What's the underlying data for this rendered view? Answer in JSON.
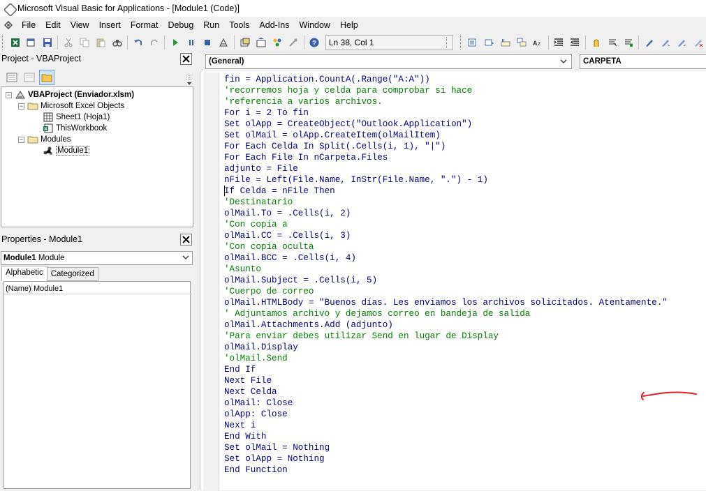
{
  "window": {
    "title": "Microsoft Visual Basic for Applications - [Module1 (Code)]"
  },
  "menu": {
    "items": [
      {
        "label": "File"
      },
      {
        "label": "Edit"
      },
      {
        "label": "View"
      },
      {
        "label": "Insert"
      },
      {
        "label": "Format"
      },
      {
        "label": "Debug"
      },
      {
        "label": "Run"
      },
      {
        "label": "Tools"
      },
      {
        "label": "Add-Ins"
      },
      {
        "label": "Window"
      },
      {
        "label": "Help"
      }
    ]
  },
  "toolbar": {
    "status": "Ln 38, Col 1",
    "icons_left": [
      "excel-icon",
      "insert-userform-icon",
      "save-icon",
      "cut-icon",
      "copy-icon",
      "paste-icon",
      "find-icon",
      "undo-icon",
      "redo-icon"
    ],
    "icons_run": [
      "run-icon",
      "pause-icon",
      "stop-icon",
      "design-mode-icon",
      "project-explorer-icon",
      "properties-icon",
      "object-browser-icon",
      "toolbox-icon",
      "help-icon"
    ],
    "icons_right": [
      "list-properties-icon",
      "list-constants-icon",
      "quick-info-icon",
      "parameter-info-icon",
      "complete-word-icon",
      "indent-icon",
      "outdent-icon",
      "toggle-breakpoint-icon",
      "comment-block-icon",
      "uncomment-block-icon",
      "toggle-bookmark-icon",
      "next-bookmark-icon",
      "previous-bookmark-icon",
      "clear-bookmarks-icon"
    ]
  },
  "project": {
    "title": "Project - VBAProject",
    "tree": [
      {
        "label": "VBAProject (Enviador.xlsm)",
        "bold": true
      },
      {
        "label": "Microsoft Excel Objects"
      },
      {
        "label": "Sheet1 (Hoja1)"
      },
      {
        "label": "ThisWorkbook"
      },
      {
        "label": "Modules"
      },
      {
        "label": "Module1"
      }
    ]
  },
  "properties": {
    "title": "Properties - Module1",
    "object_name": "Module1",
    "object_type": "Module",
    "tabs": [
      {
        "label": "Alphabetic"
      },
      {
        "label": "Categorized"
      }
    ],
    "rows": [
      {
        "name": "(Name)",
        "value": "Module1"
      }
    ]
  },
  "code": {
    "object_combo": "(General)",
    "proc_combo": "CARPETA",
    "lines": [
      {
        "text": "fin = Application.CountA(.Range(\"A:A\"))",
        "comment": false
      },
      {
        "text": "'recorremos hoja y celda para comprobar si hace",
        "comment": true
      },
      {
        "text": "'referencia a varios archivos.",
        "comment": true
      },
      {
        "text": "For i = 2 To fin",
        "comment": false
      },
      {
        "text": "Set olApp = CreateObject(\"Outlook.Application\")",
        "comment": false
      },
      {
        "text": "Set olMail = olApp.CreateItem(olMailItem)",
        "comment": false
      },
      {
        "text": "For Each Celda In Split(.Cells(i, 1), \"|\")",
        "comment": false
      },
      {
        "text": "For Each File In nCarpeta.Files",
        "comment": false
      },
      {
        "text": "adjunto = File",
        "comment": false
      },
      {
        "text": "nFile = Left(File.Name, InStr(File.Name, \".\") - 1)",
        "comment": false
      },
      {
        "text": "If Celda = nFile Then",
        "comment": false
      },
      {
        "text": "'Destinatario",
        "comment": true
      },
      {
        "text": "olMail.To = .Cells(i, 2)",
        "comment": false
      },
      {
        "text": "'Con copia a",
        "comment": true
      },
      {
        "text": "olMail.CC = .Cells(i, 3)",
        "comment": false
      },
      {
        "text": "'Con copia oculta",
        "comment": true
      },
      {
        "text": "olMail.BCC = .Cells(i, 4)",
        "comment": false
      },
      {
        "text": "'Asunto",
        "comment": true
      },
      {
        "text": "olMail.Subject = .Cells(i, 5)",
        "comment": false
      },
      {
        "text": "'Cuerpo de correo",
        "comment": true
      },
      {
        "text": "olMail.HTMLBody = \"Buenos días. Les enviamos los archivos solicitados. Atentamente.\"",
        "comment": false
      },
      {
        "text": "' Adjuntamos archivo y dejamos correo en bandeja de salida",
        "comment": true
      },
      {
        "text": "olMail.Attachments.Add (adjunto)",
        "comment": false
      },
      {
        "text": "'Para enviar debes utilizar Send en lugar de Display",
        "comment": true
      },
      {
        "text": "olMail.Display",
        "comment": false
      },
      {
        "text": "'olMail.Send",
        "comment": true
      },
      {
        "text": "End If",
        "comment": false
      },
      {
        "text": "Next File",
        "comment": false
      },
      {
        "text": "Next Celda",
        "comment": false
      },
      {
        "text": "olMail: Close",
        "comment": false
      },
      {
        "text": "olApp: Close",
        "comment": false
      },
      {
        "text": "Next i",
        "comment": false
      },
      {
        "text": "End With",
        "comment": false
      },
      {
        "text": "Set olMail = Nothing",
        "comment": false
      },
      {
        "text": "Set olApp = Nothing",
        "comment": false
      },
      {
        "text": "End Function",
        "comment": false
      }
    ]
  },
  "colors": {
    "keyword": "#000080",
    "comment": "#008000",
    "annotation": "#e0202a"
  }
}
